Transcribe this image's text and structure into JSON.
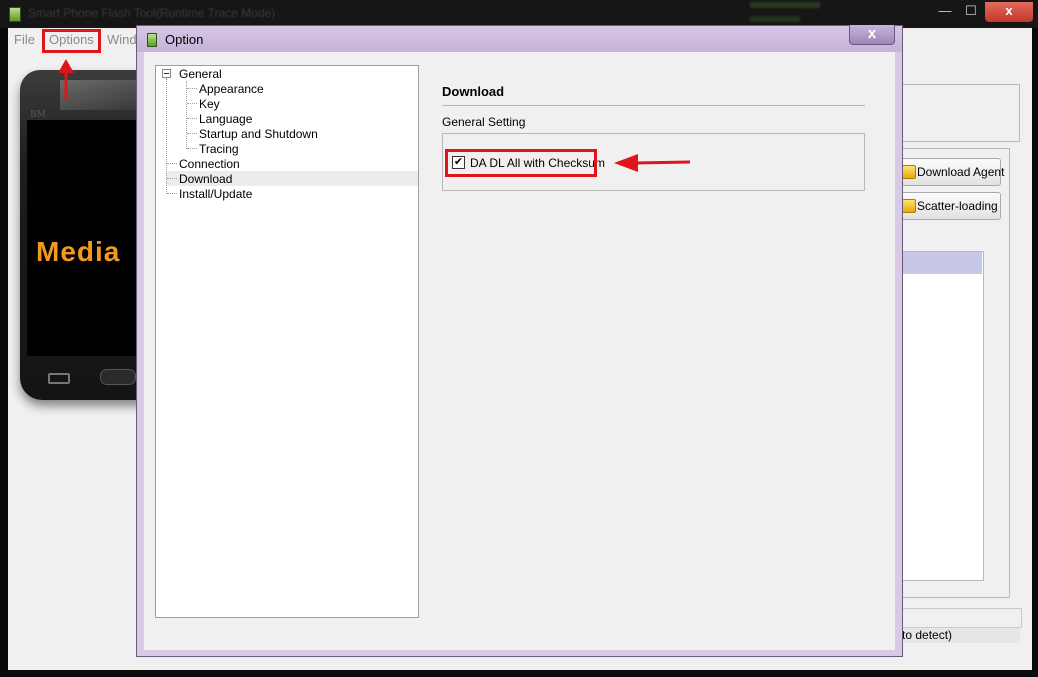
{
  "main_window": {
    "title": "Smart Phone Flash Tool(Runtime Trace Mode)",
    "menu": {
      "file": "File",
      "options": "Options",
      "window": "Wind"
    },
    "window_controls": {
      "minimize": "—",
      "maximize": "☐",
      "close": "x"
    },
    "phone_brand": "BM",
    "phone_screen_text": "Media",
    "right_buttons": {
      "download_agent": "Download Agent",
      "scatter_loading": "Scatter-loading"
    },
    "status_text": "to detect)"
  },
  "dialog": {
    "title": "Option",
    "close_label": "x",
    "tree": {
      "general": "General",
      "appearance": "Appearance",
      "key": "Key",
      "language": "Language",
      "startup_shutdown": "Startup and Shutdown",
      "tracing": "Tracing",
      "connection": "Connection",
      "download": "Download",
      "install_update": "Install/Update"
    },
    "selected_node": "Download",
    "panel": {
      "heading": "Download",
      "group_label": "General Setting",
      "checkbox_label": "DA DL All with Checksum",
      "checkbox_checked": true
    }
  },
  "colors": {
    "annotation_red": "#e0151b",
    "dialog_frame": "#d8c9e4",
    "phone_text": "#f39a1e"
  }
}
